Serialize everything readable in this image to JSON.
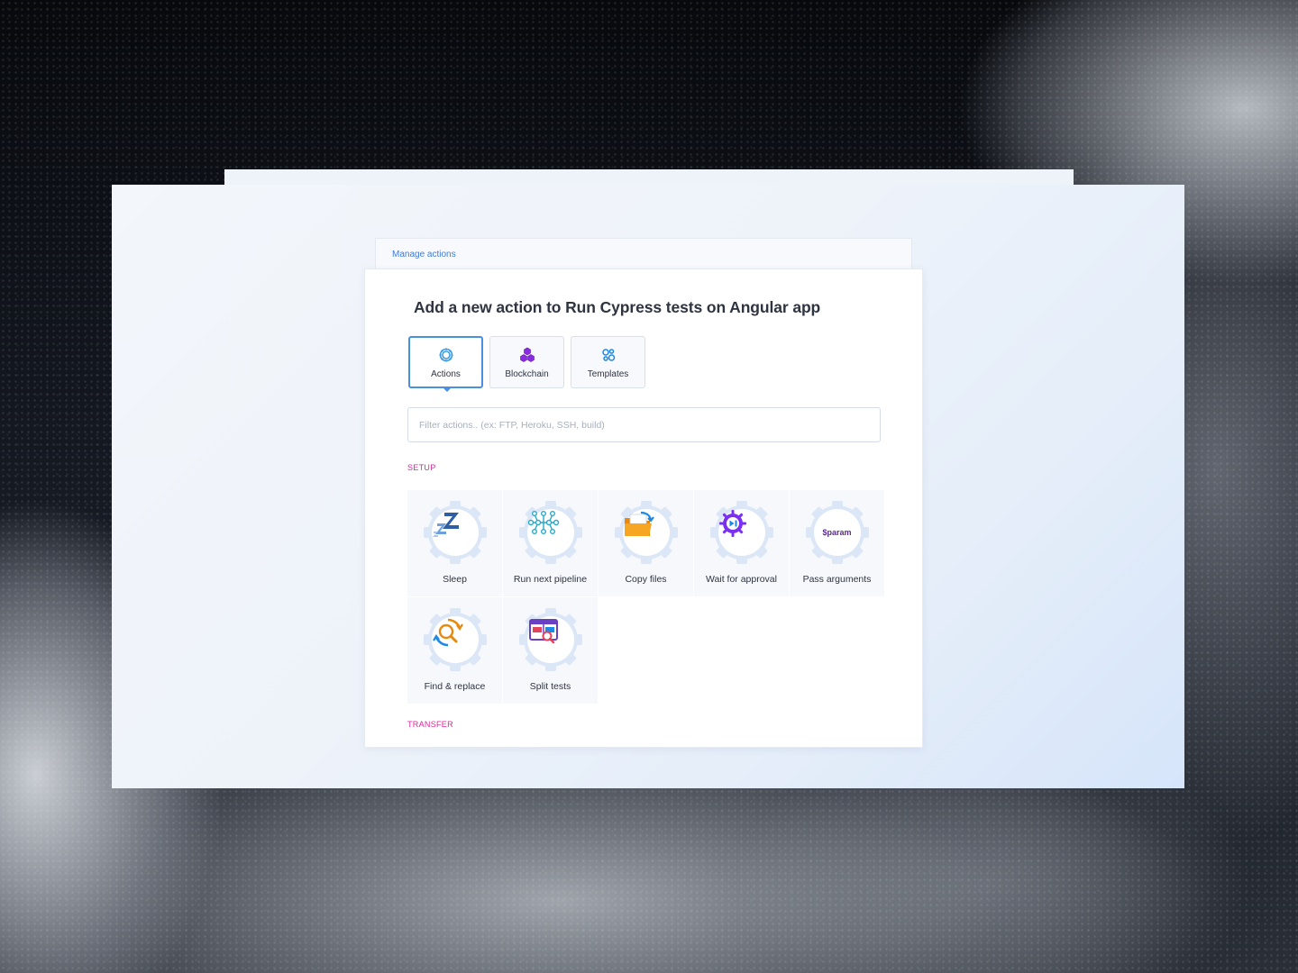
{
  "breadcrumb": {
    "link": "Manage actions"
  },
  "dialog": {
    "title": "Add a new action to Run Cypress tests on Angular app",
    "tabs": [
      {
        "label": "Actions",
        "icon": "gear-icon",
        "active": true
      },
      {
        "label": "Blockchain",
        "icon": "blockchain-icon",
        "active": false
      },
      {
        "label": "Templates",
        "icon": "templates-icon",
        "active": false
      }
    ],
    "filter": {
      "placeholder": "Filter actions.. (ex: FTP, Heroku, SSH, build)",
      "value": ""
    },
    "sections": [
      {
        "label": "SETUP",
        "items": [
          {
            "label": "Sleep",
            "icon": "sleep-icon"
          },
          {
            "label": "Run next pipeline",
            "icon": "pipeline-icon"
          },
          {
            "label": "Copy files",
            "icon": "folder-icon"
          },
          {
            "label": "Wait for approval",
            "icon": "play-pause-icon"
          },
          {
            "label": "Pass arguments",
            "icon": "sparam-icon",
            "icon_text": "$param"
          },
          {
            "label": "Find & replace",
            "icon": "find-replace-icon"
          },
          {
            "label": "Split tests",
            "icon": "split-tests-icon"
          }
        ]
      },
      {
        "label": "TRANSFER",
        "items": []
      }
    ]
  },
  "colors": {
    "accent": "#4a90e2",
    "section_label": "#e0249a",
    "gear": "#dbe7f6"
  }
}
